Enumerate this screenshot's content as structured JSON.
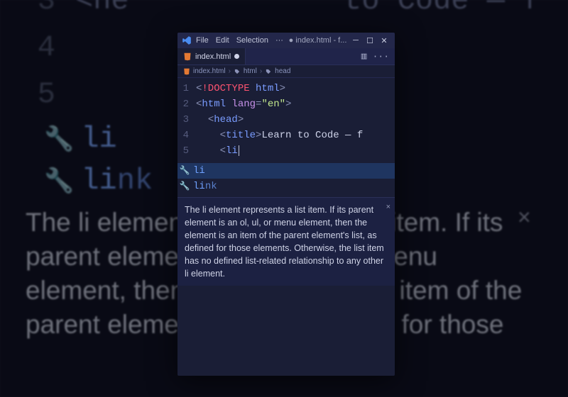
{
  "bg": {
    "lines": [
      {
        "num": "3",
        "html": "<he"
      },
      {
        "num": "4",
        "html": ""
      },
      {
        "num": "5",
        "html": ""
      }
    ],
    "suggest": [
      {
        "full": "li"
      },
      {
        "full": "link",
        "prefix": "li",
        "rest": "nk"
      }
    ],
    "desc": "The li element represents a list item. If its parent element is an ol, ul, or menu element, then the element is an item of the parent element's list, as defined for those",
    "right_text": "to Code — f"
  },
  "menu": {
    "file": "File",
    "edit": "Edit",
    "selection": "Selection",
    "more": "···"
  },
  "title_center": "● index.html - f...",
  "tab": {
    "label": "index.html"
  },
  "tab_actions": {
    "layout": "▥",
    "more": "···"
  },
  "breadcrumbs": [
    {
      "icon": "file",
      "label": "index.html"
    },
    {
      "icon": "tag",
      "label": "html"
    },
    {
      "icon": "tag",
      "label": "head"
    }
  ],
  "editor_lines": [
    {
      "num": "1",
      "indent": "",
      "parts": [
        {
          "c": "brkt",
          "t": "<"
        },
        {
          "c": "doctype",
          "t": "!DOCTYPE "
        },
        {
          "c": "tagn",
          "t": "html"
        },
        {
          "c": "brkt",
          "t": ">"
        }
      ]
    },
    {
      "num": "2",
      "indent": "",
      "parts": [
        {
          "c": "brkt",
          "t": "<"
        },
        {
          "c": "tagn",
          "t": "html "
        },
        {
          "c": "attr",
          "t": "lang"
        },
        {
          "c": "brkt",
          "t": "="
        },
        {
          "c": "str",
          "t": "\"en\""
        },
        {
          "c": "brkt",
          "t": ">"
        }
      ]
    },
    {
      "num": "3",
      "indent": "  ",
      "parts": [
        {
          "c": "brkt",
          "t": "<"
        },
        {
          "c": "tagn",
          "t": "head"
        },
        {
          "c": "brkt",
          "t": ">"
        }
      ]
    },
    {
      "num": "4",
      "indent": "    ",
      "parts": [
        {
          "c": "brkt",
          "t": "<"
        },
        {
          "c": "tagn",
          "t": "title"
        },
        {
          "c": "brkt",
          "t": ">"
        },
        {
          "c": "txt",
          "t": "Learn to Code — f"
        }
      ]
    },
    {
      "num": "5",
      "indent": "    ",
      "parts": [
        {
          "c": "brkt",
          "t": "<"
        },
        {
          "c": "tagn",
          "t": "li"
        }
      ],
      "cursor": true
    }
  ],
  "suggestions": [
    {
      "label": "li",
      "prefix": "li",
      "rest": "",
      "selected": true
    },
    {
      "label": "link",
      "prefix": "li",
      "rest": "nk",
      "selected": false
    }
  ],
  "doc": "The li element represents a list item. If its parent element is an ol, ul, or menu element, then the element is an item of the parent element's list, as defined for those elements. Otherwise, the list item has no defined list-related relationship to any other li element.",
  "close_x": "×"
}
